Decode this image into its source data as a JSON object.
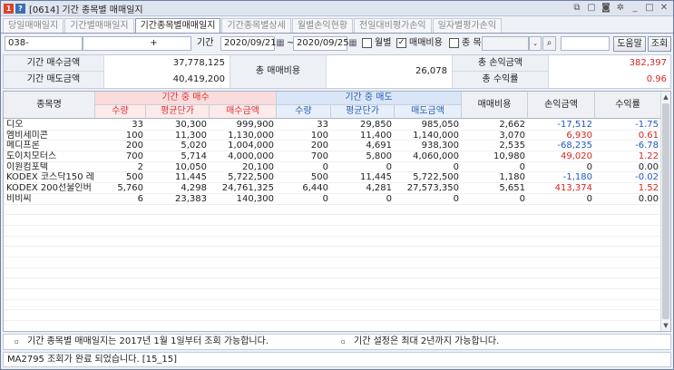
{
  "window": {
    "title": "[0614] 기간 종목별 매매일지"
  },
  "tabs": [
    {
      "label": "당일매매일지"
    },
    {
      "label": "기간별매매일지"
    },
    {
      "label": "기간종목별매매일지"
    },
    {
      "label": "기간종목별상세"
    },
    {
      "label": "월별손익현황"
    },
    {
      "label": "전일대비평가손익"
    },
    {
      "label": "일자별평가손익"
    }
  ],
  "toolbar": {
    "account": "038-",
    "account_suffix": "+",
    "period_label": "기간",
    "date_from": "2020/09/21",
    "date_sep": "~",
    "date_to": "2020/09/25",
    "monthly_label": "월별",
    "fee_label": "매매비용",
    "stock_label": "종 목",
    "help_button": "도움말",
    "query_button": "조회"
  },
  "summary": {
    "buy_total_label": "기간 매수금액",
    "buy_total": "37,778,125",
    "sell_total_label": "기간 매도금액",
    "sell_total": "40,419,200",
    "fee_label": "총 매매비용",
    "fee_total": "26,078",
    "pnl_label": "총 손익금액",
    "pnl_total": "382,397",
    "rate_label": "총 수익률",
    "rate_total": "0.96"
  },
  "grid": {
    "headers": {
      "name": "종목명",
      "buy_group": "기간 중 매수",
      "sell_group": "기간 중 매도",
      "qty": "수량",
      "avg_price": "평균단가",
      "buy_amount": "매수금액",
      "sell_amount": "매도금액",
      "fee": "매매비용",
      "pnl": "손익금액",
      "rate": "수익률"
    },
    "rows": [
      {
        "name": "디오",
        "bq": "33",
        "bp": "30,300",
        "ba": "999,900",
        "sq": "33",
        "sp": "29,850",
        "sa": "985,050",
        "fee": "2,662",
        "pnl": "-17,512",
        "rate": "-1.75",
        "sign": "neg"
      },
      {
        "name": "엠비세미콘",
        "bq": "100",
        "bp": "11,300",
        "ba": "1,130,000",
        "sq": "100",
        "sp": "11,400",
        "sa": "1,140,000",
        "fee": "3,070",
        "pnl": "6,930",
        "rate": "0.61",
        "sign": "pos"
      },
      {
        "name": "메디프론",
        "bq": "200",
        "bp": "5,020",
        "ba": "1,004,000",
        "sq": "200",
        "sp": "4,691",
        "sa": "938,300",
        "fee": "2,535",
        "pnl": "-68,235",
        "rate": "-6.78",
        "sign": "neg"
      },
      {
        "name": "도이치모터스",
        "bq": "700",
        "bp": "5,714",
        "ba": "4,000,000",
        "sq": "700",
        "sp": "5,800",
        "sa": "4,060,000",
        "fee": "10,980",
        "pnl": "49,020",
        "rate": "1.22",
        "sign": "pos"
      },
      {
        "name": "이원컴포텍",
        "bq": "2",
        "bp": "10,050",
        "ba": "20,100",
        "sq": "0",
        "sp": "0",
        "sa": "0",
        "fee": "0",
        "pnl": "0",
        "rate": "0.00",
        "sign": "zero"
      },
      {
        "name": "KODEX 코스닥150 레",
        "bq": "500",
        "bp": "11,445",
        "ba": "5,722,500",
        "sq": "500",
        "sp": "11,445",
        "sa": "5,722,500",
        "fee": "1,180",
        "pnl": "-1,180",
        "rate": "-0.02",
        "sign": "neg"
      },
      {
        "name": "KODEX 200선물인버",
        "bq": "5,760",
        "bp": "4,298",
        "ba": "24,761,325",
        "sq": "6,440",
        "sp": "4,281",
        "sa": "27,573,350",
        "fee": "5,651",
        "pnl": "413,374",
        "rate": "1.52",
        "sign": "pos"
      },
      {
        "name": "비비씨",
        "bq": "6",
        "bp": "23,383",
        "ba": "140,300",
        "sq": "0",
        "sp": "0",
        "sa": "0",
        "fee": "0",
        "pnl": "0",
        "rate": "0.00",
        "sign": "zero"
      }
    ],
    "empty_rows": 12
  },
  "notes": {
    "note1": "기간 종목별 매매일지는 2017년 1월 1일부터 조회 가능합니다.",
    "note2": "기간 설정은 최대 2년까지 가능합니다."
  },
  "status": {
    "message": "MA2795 조회가 완료 되었습니다. [15_15]"
  }
}
